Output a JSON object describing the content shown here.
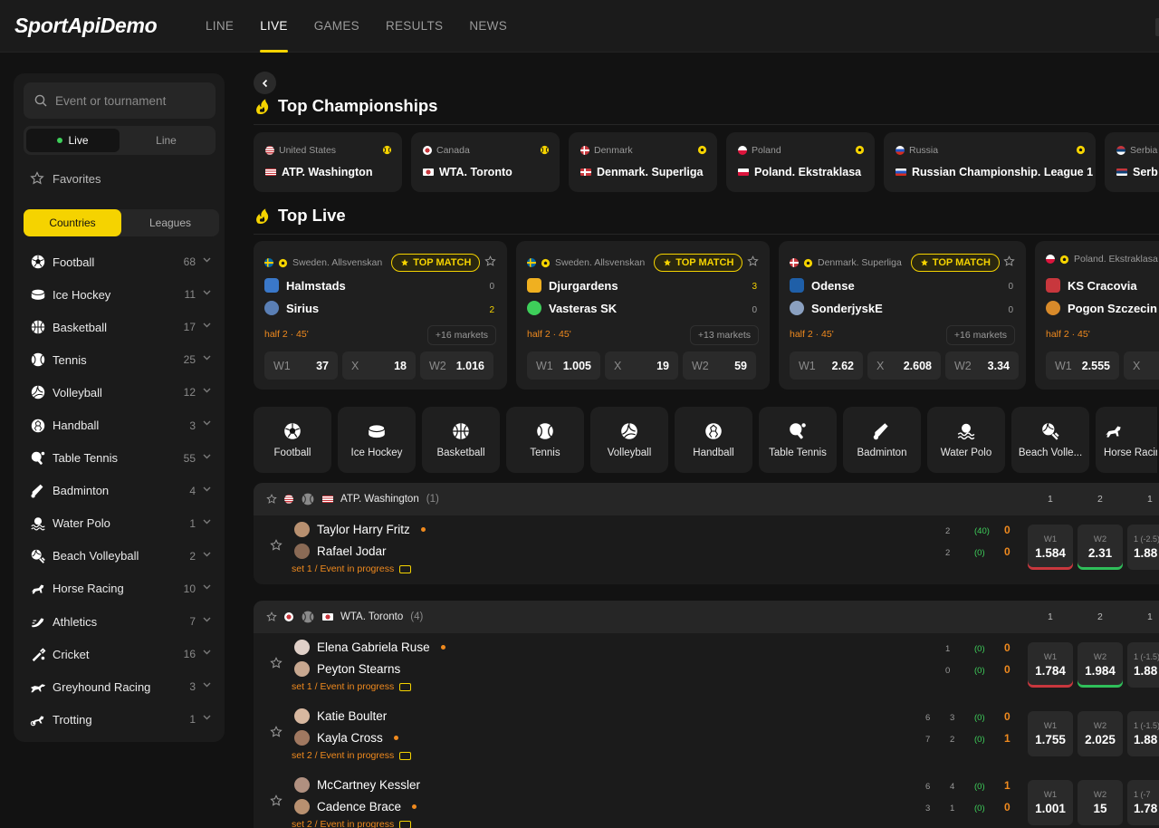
{
  "header": {
    "logo": "SportApiDemo",
    "nav": [
      "LINE",
      "LIVE",
      "GAMES",
      "RESULTS",
      "NEWS"
    ],
    "active_nav": "LIVE"
  },
  "sidebar": {
    "search_placeholder": "Event or tournament",
    "mode_tabs": [
      "Live",
      "Line"
    ],
    "favorites": "Favorites",
    "group_tabs": [
      "Countries",
      "Leagues"
    ],
    "sports": [
      {
        "name": "Football",
        "count": "68",
        "icon": "soccer-ball-icon"
      },
      {
        "name": "Ice Hockey",
        "count": "11",
        "icon": "hockey-puck-icon"
      },
      {
        "name": "Basketball",
        "count": "17",
        "icon": "basketball-icon"
      },
      {
        "name": "Tennis",
        "count": "25",
        "icon": "tennis-ball-icon"
      },
      {
        "name": "Volleyball",
        "count": "12",
        "icon": "volleyball-icon"
      },
      {
        "name": "Handball",
        "count": "3",
        "icon": "handball-icon"
      },
      {
        "name": "Table Tennis",
        "count": "55",
        "icon": "table-tennis-icon"
      },
      {
        "name": "Badminton",
        "count": "4",
        "icon": "shuttlecock-icon"
      },
      {
        "name": "Water Polo",
        "count": "1",
        "icon": "water-polo-icon"
      },
      {
        "name": "Beach Volleyball",
        "count": "2",
        "icon": "beach-volleyball-icon"
      },
      {
        "name": "Horse Racing",
        "count": "10",
        "icon": "horse-icon"
      },
      {
        "name": "Athletics",
        "count": "7",
        "icon": "running-shoe-icon"
      },
      {
        "name": "Cricket",
        "count": "16",
        "icon": "cricket-bat-icon"
      },
      {
        "name": "Greyhound Racing",
        "count": "3",
        "icon": "greyhound-icon"
      },
      {
        "name": "Trotting",
        "count": "1",
        "icon": "trotting-horse-icon"
      }
    ]
  },
  "top_championships": {
    "title": "Top Championships",
    "items": [
      {
        "country": "United States",
        "name": "ATP. Washington",
        "ball": "tennis"
      },
      {
        "country": "Canada",
        "name": "WTA. Toronto",
        "ball": "tennis"
      },
      {
        "country": "Denmark",
        "name": "Denmark. Superliga",
        "ball": "football"
      },
      {
        "country": "Poland",
        "name": "Poland. Ekstraklasa",
        "ball": "football"
      },
      {
        "country": "Russia",
        "name": "Russian Championship. League 1",
        "ball": "football"
      },
      {
        "country": "Serbia",
        "name": "Serb"
      }
    ]
  },
  "top_live": {
    "title": "Top Live",
    "badge": "TOP MATCH",
    "cards": [
      {
        "league": "Sweden. Allsvenskan",
        "home": "Halmstads",
        "away": "Sirius",
        "home_score": "0",
        "away_score": "2",
        "time": "half 2 · 45'",
        "markets": "+16 markets",
        "odds": [
          [
            "W1",
            "37"
          ],
          [
            "X",
            "18"
          ],
          [
            "W2",
            "1.016"
          ]
        ]
      },
      {
        "league": "Sweden. Allsvenskan",
        "home": "Djurgardens",
        "away": "Vasteras SK",
        "home_score": "3",
        "away_score": "0",
        "time": "half 2 · 45'",
        "markets": "+13 markets",
        "odds": [
          [
            "W1",
            "1.005"
          ],
          [
            "X",
            "19"
          ],
          [
            "W2",
            "59"
          ]
        ]
      },
      {
        "league": "Denmark. Superliga",
        "home": "Odense",
        "away": "SonderjyskE",
        "home_score": "0",
        "away_score": "0",
        "time": "half 2 · 45'",
        "markets": "+16 markets",
        "odds": [
          [
            "W1",
            "2.62"
          ],
          [
            "X",
            "2.608"
          ],
          [
            "W2",
            "3.34"
          ]
        ]
      },
      {
        "league": "Poland. Ekstraklasa",
        "home": "KS Cracovia",
        "away": "Pogon Szczecin",
        "time": "half 2 · 45'",
        "odds": [
          [
            "W1",
            "2.555"
          ],
          [
            "X",
            ""
          ]
        ]
      }
    ]
  },
  "sport_tiles": [
    "Football",
    "Ice Hockey",
    "Basketball",
    "Tennis",
    "Volleyball",
    "Handball",
    "Table Tennis",
    "Badminton",
    "Water Polo",
    "Beach Volle...",
    "Horse Racin"
  ],
  "tournaments": [
    {
      "name": "ATP. Washington",
      "count": "(1)",
      "cols": [
        "1",
        "2",
        "1"
      ],
      "events": [
        {
          "p1": "Taylor Harry Fritz",
          "p2": "Rafael Jodar",
          "serve": 1,
          "status": "set 1 / Event in progress",
          "s1": [
            "2",
            "(40)",
            "0"
          ],
          "s2": [
            "2",
            "(0)",
            "0"
          ],
          "odds": [
            {
              "l": "W1",
              "v": "1.584",
              "t": "dn"
            },
            {
              "l": "W2",
              "v": "2.31",
              "t": "up"
            },
            {
              "l": "1 (-2.5)",
              "v": "1.88"
            }
          ]
        }
      ]
    },
    {
      "name": "WTA. Toronto",
      "count": "(4)",
      "cols": [
        "1",
        "2",
        "1"
      ],
      "events": [
        {
          "p1": "Elena Gabriela Ruse",
          "p2": "Peyton Stearns",
          "serve": 1,
          "status": "set 1 / Event in progress",
          "s1": [
            "1",
            "(0)",
            "0"
          ],
          "s2": [
            "0",
            "(0)",
            "0"
          ],
          "odds": [
            {
              "l": "W1",
              "v": "1.784",
              "t": "dn"
            },
            {
              "l": "W2",
              "v": "1.984",
              "t": "up"
            },
            {
              "l": "1 (-1.5)",
              "v": "1.88"
            }
          ]
        },
        {
          "p1": "Katie Boulter",
          "p2": "Kayla Cross",
          "serve": 2,
          "status": "set 2 / Event in progress",
          "s1": [
            "6",
            "3",
            "(0)",
            "0"
          ],
          "s2": [
            "7",
            "2",
            "(0)",
            "1"
          ],
          "odds": [
            {
              "l": "W1",
              "v": "1.755"
            },
            {
              "l": "W2",
              "v": "2.025"
            },
            {
              "l": "1 (-1.5)",
              "v": "1.88"
            }
          ]
        },
        {
          "p1": "McCartney Kessler",
          "p2": "Cadence Brace",
          "serve": 2,
          "status": "set 2 / Event in progress",
          "s1": [
            "6",
            "4",
            "(0)",
            "1"
          ],
          "s2": [
            "3",
            "1",
            "(0)",
            "0"
          ],
          "odds": [
            {
              "l": "W1",
              "v": "1.001"
            },
            {
              "l": "W2",
              "v": "15"
            },
            {
              "l": "1 (-7",
              "v": "1.78"
            }
          ]
        }
      ]
    }
  ],
  "colors": {
    "accent": "#f5d300",
    "live": "#3ecf5a",
    "progress": "#f08a1e",
    "odd_down": "#c8373d",
    "odd_up": "#2fbf5a"
  }
}
